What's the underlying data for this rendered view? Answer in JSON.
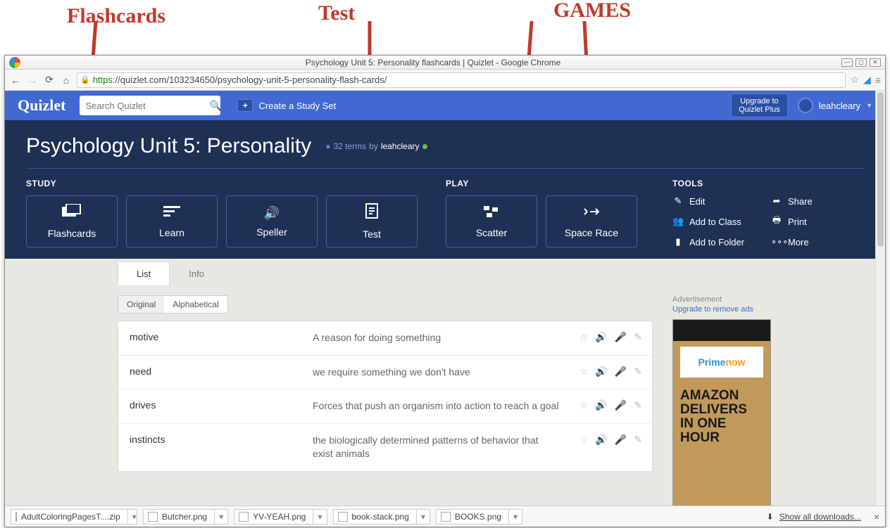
{
  "annotations": {
    "flashcards": "Flashcards",
    "test": "Test",
    "games": "GAMES"
  },
  "browser": {
    "title": "Psychology Unit 5: Personality flashcards | Quizlet - Google Chrome",
    "url_proto": "https",
    "url_rest": "://quizlet.com/103234650/psychology-unit-5-personality-flash-cards/"
  },
  "header": {
    "logo": "Quizlet",
    "search_placeholder": "Search Quizlet",
    "create_label": "Create a Study Set",
    "upgrade_line1": "Upgrade to",
    "upgrade_line2": "Quizlet Plus",
    "username": "leahcleary"
  },
  "hero": {
    "set_title": "Psychology Unit 5: Personality",
    "term_count": "32 terms",
    "by": "by",
    "author": "leahcleary",
    "study_label": "STUDY",
    "play_label": "PLAY",
    "tools_label": "TOOLS",
    "study_buttons": [
      {
        "label": "Flashcards"
      },
      {
        "label": "Learn"
      },
      {
        "label": "Speller"
      },
      {
        "label": "Test"
      }
    ],
    "play_buttons": [
      {
        "label": "Scatter"
      },
      {
        "label": "Space Race"
      }
    ],
    "tools": [
      {
        "label": "Edit"
      },
      {
        "label": "Share"
      },
      {
        "label": "Add to Class"
      },
      {
        "label": "Print"
      },
      {
        "label": "Add to Folder"
      },
      {
        "label": "More"
      }
    ]
  },
  "tabs": {
    "list": "List",
    "info": "Info"
  },
  "sort": {
    "original": "Original",
    "alpha": "Alphabetical"
  },
  "terms": [
    {
      "name": "motive",
      "def": "A reason for doing something"
    },
    {
      "name": "need",
      "def": "we require something we don't have"
    },
    {
      "name": "drives",
      "def": "Forces that push an organism into action to reach a goal"
    },
    {
      "name": "instincts",
      "def": "the biologically determined patterns of behavior that exist animals"
    }
  ],
  "ads": {
    "head": "Advertisement",
    "remove": "Upgrade to remove ads",
    "prime1": "Prime",
    "prime2": "now",
    "big": "AMAZON DELIVERS IN ONE HOUR"
  },
  "downloads": {
    "items": [
      "AdultColoringPagesT....zip",
      "Butcher.png",
      "YV-YEAH.png",
      "book-stack.png",
      "BOOKS.png"
    ],
    "show_all": "Show all downloads..."
  }
}
